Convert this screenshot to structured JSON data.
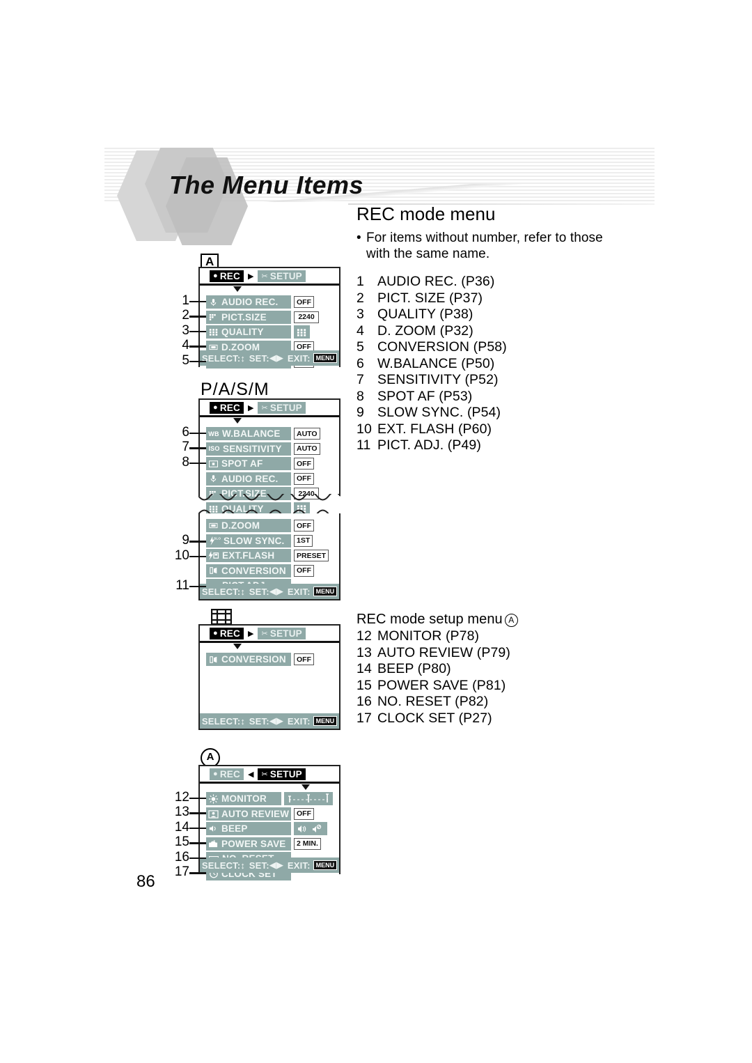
{
  "page": {
    "title": "The Menu Items",
    "number": "86"
  },
  "right_column": {
    "rec_mode_heading": "REC mode menu",
    "note_bullet": "•",
    "note_text": "For items without number, refer to those with the same name.",
    "rec_items": [
      {
        "num": "1",
        "label": "AUDIO REC. (P36)"
      },
      {
        "num": "2",
        "label": "PICT. SIZE (P37)"
      },
      {
        "num": "3",
        "label": "QUALITY (P38)"
      },
      {
        "num": "4",
        "label": "D. ZOOM (P32)"
      },
      {
        "num": "5",
        "label": "CONVERSION (P58)"
      },
      {
        "num": "6",
        "label": "W.BALANCE (P50)"
      },
      {
        "num": "7",
        "label": "SENSITIVITY (P52)"
      },
      {
        "num": "8",
        "label": "SPOT AF (P53)"
      },
      {
        "num": "9",
        "label": "SLOW SYNC. (P54)"
      },
      {
        "num": "10",
        "label": "EXT. FLASH (P60)"
      },
      {
        "num": "11",
        "label": "PICT. ADJ. (P49)"
      }
    ],
    "setup_heading": "REC mode setup menu",
    "setup_heading_marker": "A",
    "setup_items": [
      {
        "num": "12",
        "label": "MONITOR (P78)"
      },
      {
        "num": "13",
        "label": "AUTO REVIEW (P79)"
      },
      {
        "num": "14",
        "label": "BEEP (P80)"
      },
      {
        "num": "15",
        "label": "POWER SAVE (P81)"
      },
      {
        "num": "16",
        "label": "NO. RESET (P82)"
      },
      {
        "num": "17",
        "label": "CLOCK SET (P27)"
      }
    ]
  },
  "shared": {
    "tab_rec": "REC",
    "tab_setup": "SETUP",
    "tab_arrow_right": "▶",
    "tab_arrow_left": "◀",
    "status_select": "SELECT:",
    "status_set": "SET:",
    "status_exit": "EXIT:",
    "status_select_glyph": "↕",
    "status_set_glyph": "◀▶",
    "status_menu_key": "MENU"
  },
  "screens": {
    "auto": {
      "marker": "A",
      "marker_bracket_left": "⌈",
      "selected_tab": "REC",
      "rows": [
        {
          "lead": "1",
          "icon": "microphone-icon",
          "label": "AUDIO REC.",
          "value": "OFF",
          "value_style": "box"
        },
        {
          "lead": "2",
          "icon": "pict-size-icon",
          "label": "PICT.SIZE",
          "value": "2240",
          "value_style": "box"
        },
        {
          "lead": "3",
          "icon": "quality-icon",
          "label": "QUALITY",
          "value": "",
          "value_style": "grid"
        },
        {
          "lead": "4",
          "icon": "d-zoom-icon",
          "label": "D.ZOOM",
          "value": "OFF",
          "value_style": "box"
        },
        {
          "lead": "5",
          "icon": "conversion-icon",
          "label": "CONVERSION",
          "value": "OFF",
          "value_style": "box"
        }
      ]
    },
    "pasm": {
      "mode_label": "P/A/S/M",
      "selected_tab": "REC",
      "rows_top": [
        {
          "lead": "6",
          "icon": "wb-icon",
          "label": "W.BALANCE",
          "value": "AUTO",
          "value_style": "box"
        },
        {
          "lead": "7",
          "icon": "iso-icon",
          "label": "SENSITIVITY",
          "value": "AUTO",
          "value_style": "box"
        },
        {
          "lead": "8",
          "icon": "spot-af-icon",
          "label": "SPOT AF",
          "value": "OFF",
          "value_style": "box"
        },
        {
          "lead": "",
          "icon": "microphone-icon",
          "label": "AUDIO REC.",
          "value": "OFF",
          "value_style": "box"
        },
        {
          "lead": "",
          "icon": "pict-size-icon",
          "label": "PICT.SIZE",
          "value": "2240",
          "value_style": "box"
        },
        {
          "lead": "",
          "icon": "quality-icon",
          "label": "QUALITY",
          "value": "",
          "value_style": "grid"
        }
      ],
      "rows_bottom": [
        {
          "lead": "",
          "icon": "d-zoom-icon",
          "label": "D.ZOOM",
          "value": "OFF",
          "value_style": "box"
        },
        {
          "lead": "9",
          "icon": "slow-sync-icon",
          "label": "SLOW SYNC.",
          "value": "1ST",
          "value_style": "box"
        },
        {
          "lead": "10",
          "icon": "ext-flash-icon",
          "label": "EXT.FLASH",
          "value": "PRESET",
          "value_style": "box"
        },
        {
          "lead": "",
          "icon": "conversion-icon",
          "label": "CONVERSION",
          "value": "OFF",
          "value_style": "box"
        },
        {
          "lead": "11",
          "icon": "pict-adj-icon",
          "label": "PICT.ADJ.",
          "value": "",
          "value_style": "none"
        }
      ]
    },
    "movie": {
      "marker": "film-strip-icon",
      "selected_tab": "REC",
      "rows": [
        {
          "lead": "",
          "icon": "conversion-icon",
          "label": "CONVERSION",
          "value": "OFF",
          "value_style": "box"
        }
      ]
    },
    "setup": {
      "marker": "A",
      "selected_tab": "SETUP",
      "rows": [
        {
          "lead": "12",
          "icon": "brightness-icon",
          "label": "MONITOR",
          "value": "",
          "value_style": "scale"
        },
        {
          "lead": "13",
          "icon": "auto-review-icon",
          "label": "AUTO REVIEW",
          "value": "OFF",
          "value_style": "box"
        },
        {
          "lead": "14",
          "icon": "speaker-icon",
          "label": "BEEP",
          "value": "",
          "value_style": "beep"
        },
        {
          "lead": "15",
          "icon": "power-save-icon",
          "label": "POWER SAVE",
          "value": "2 MIN.",
          "value_style": "box"
        },
        {
          "lead": "16",
          "icon": "no-reset-icon",
          "label": "NO. RESET",
          "value": "",
          "value_style": "none"
        },
        {
          "lead": "17",
          "icon": "clock-icon",
          "label": "CLOCK SET",
          "value": "",
          "value_style": "none"
        }
      ]
    }
  },
  "colors": {
    "lcd_teal": "#8fa9a7",
    "lcd_text": "#f2f7f6",
    "ink": "#111111"
  }
}
